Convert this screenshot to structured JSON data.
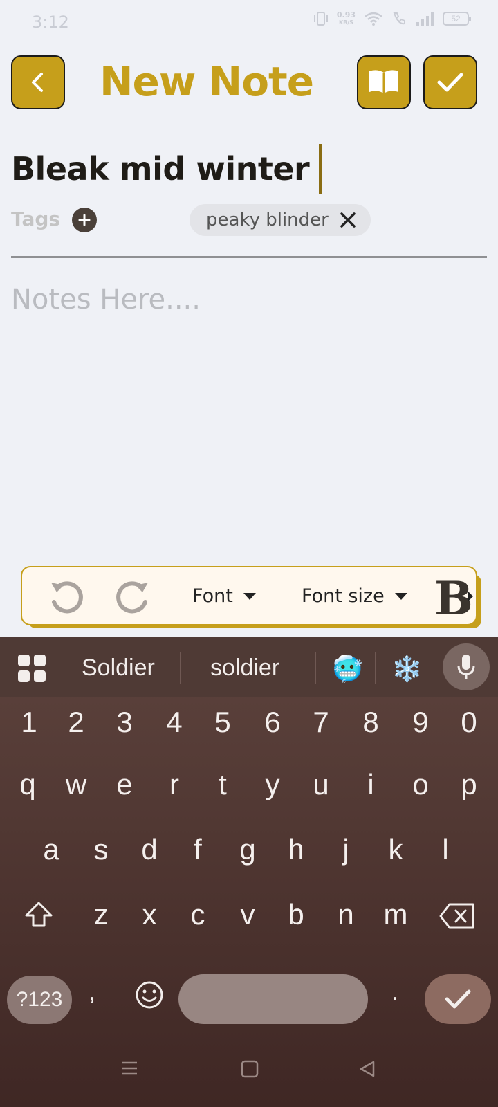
{
  "status_bar": {
    "time": "3:12",
    "net_speed_value": "0.93",
    "net_speed_unit": "KB/S",
    "battery": "52"
  },
  "header": {
    "title": "New Note",
    "back_icon": "chevron-left-icon",
    "read_icon": "open-book-icon",
    "save_icon": "checkmark-icon"
  },
  "note": {
    "title": "Bleak mid winter",
    "tags_label": "Tags",
    "tags": [
      {
        "label": "peaky blinder"
      }
    ],
    "body_placeholder": "Notes Here...."
  },
  "toolbar": {
    "font_label": "Font",
    "font_size_label": "Font size",
    "bold_label": "B"
  },
  "keyboard": {
    "suggestions": [
      "Soldier",
      "soldier"
    ],
    "emoji_suggestions": [
      "🥶",
      "❄️"
    ],
    "rows": [
      [
        "1",
        "2",
        "3",
        "4",
        "5",
        "6",
        "7",
        "8",
        "9",
        "0"
      ],
      [
        "q",
        "w",
        "e",
        "r",
        "t",
        "y",
        "u",
        "i",
        "o",
        "p"
      ],
      [
        "a",
        "s",
        "d",
        "f",
        "g",
        "h",
        "j",
        "k",
        "l"
      ],
      [
        "z",
        "x",
        "c",
        "v",
        "b",
        "n",
        "m"
      ]
    ],
    "symbols_key": "?123",
    "comma_key": ",",
    "period_key": "."
  },
  "colors": {
    "accent": "#c69f1b",
    "background": "#eff1f6",
    "keyboard_bg": "#4f3a35"
  }
}
